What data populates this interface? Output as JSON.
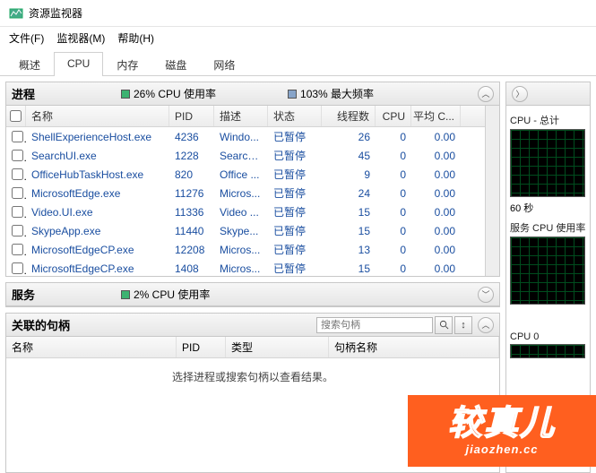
{
  "window": {
    "title": "资源监视器"
  },
  "menu": {
    "file": "文件(F)",
    "monitor": "监视器(M)",
    "help": "帮助(H)"
  },
  "tabs": {
    "overview": "概述",
    "cpu": "CPU",
    "memory": "内存",
    "disk": "磁盘",
    "network": "网络"
  },
  "processes": {
    "title": "进程",
    "cpu_usage": "26% CPU 使用率",
    "max_freq": "103% 最大频率",
    "columns": {
      "name": "名称",
      "pid": "PID",
      "desc": "描述",
      "state": "状态",
      "threads": "线程数",
      "cpu": "CPU",
      "avg": "平均 C..."
    },
    "rows": [
      {
        "name": "ShellExperienceHost.exe",
        "pid": "4236",
        "desc": "Windo...",
        "state": "已暂停",
        "threads": "26",
        "cpu": "0",
        "avg": "0.00"
      },
      {
        "name": "SearchUI.exe",
        "pid": "1228",
        "desc": "Search...",
        "state": "已暂停",
        "threads": "45",
        "cpu": "0",
        "avg": "0.00"
      },
      {
        "name": "OfficeHubTaskHost.exe",
        "pid": "820",
        "desc": "Office ...",
        "state": "已暂停",
        "threads": "9",
        "cpu": "0",
        "avg": "0.00"
      },
      {
        "name": "MicrosoftEdge.exe",
        "pid": "11276",
        "desc": "Micros...",
        "state": "已暂停",
        "threads": "24",
        "cpu": "0",
        "avg": "0.00"
      },
      {
        "name": "Video.UI.exe",
        "pid": "11336",
        "desc": "Video ...",
        "state": "已暂停",
        "threads": "15",
        "cpu": "0",
        "avg": "0.00"
      },
      {
        "name": "SkypeApp.exe",
        "pid": "11440",
        "desc": "Skype...",
        "state": "已暂停",
        "threads": "15",
        "cpu": "0",
        "avg": "0.00"
      },
      {
        "name": "MicrosoftEdgeCP.exe",
        "pid": "12208",
        "desc": "Micros...",
        "state": "已暂停",
        "threads": "13",
        "cpu": "0",
        "avg": "0.00"
      },
      {
        "name": "MicrosoftEdgeCP.exe",
        "pid": "1408",
        "desc": "Micros...",
        "state": "已暂停",
        "threads": "15",
        "cpu": "0",
        "avg": "0.00"
      }
    ]
  },
  "services": {
    "title": "服务",
    "cpu_usage": "2% CPU 使用率"
  },
  "handles": {
    "title": "关联的句柄",
    "search_placeholder": "搜索句柄",
    "columns": {
      "name": "名称",
      "pid": "PID",
      "type": "类型",
      "hname": "句柄名称"
    },
    "empty": "选择进程或搜索句柄以查看结果。"
  },
  "right": {
    "cpu_total": "CPU - 总计",
    "sixty_sec": "60 秒",
    "services_cpu": "服务 CPU 使用率",
    "cpu0": "CPU 0"
  },
  "watermark": {
    "big": "较真儿",
    "small": "jiaozhen.cc"
  }
}
